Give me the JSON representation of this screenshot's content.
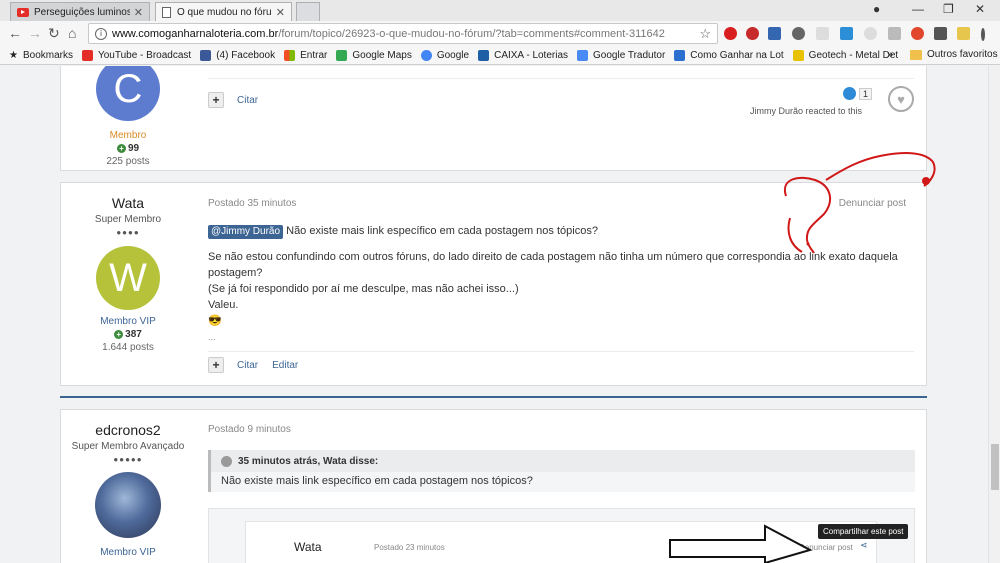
{
  "browser": {
    "tabs": [
      {
        "title": "Perseguições luminosas"
      },
      {
        "title": "O que mudou no fórum"
      }
    ],
    "url_host": "www.comoganharnaloteria.com.br",
    "url_path": "/forum/topico/26923-o-que-mudou-no-fórum/?tab=comments#comment-311642",
    "bookmarks": [
      {
        "label": "Bookmarks",
        "icon": "star-icon"
      },
      {
        "label": "YouTube - Broadcast",
        "icon": "youtube-icon"
      },
      {
        "label": "(4) Facebook",
        "icon": "facebook-icon"
      },
      {
        "label": "Entrar",
        "icon": "microsoft-icon"
      },
      {
        "label": "Google Maps",
        "icon": "maps-icon"
      },
      {
        "label": "Google",
        "icon": "google-icon"
      },
      {
        "label": "CAIXA - Loterias",
        "icon": "caixa-icon"
      },
      {
        "label": "Google Tradutor",
        "icon": "translate-icon"
      },
      {
        "label": "Como Ganhar na Lot",
        "icon": "site-icon"
      },
      {
        "label": "Geotech - Metal Det",
        "icon": "geotech-icon"
      }
    ],
    "bookmarks_overflow": "»",
    "other_bookmarks": "Outros favoritos"
  },
  "post1": {
    "avatar_letter": "C",
    "group": "Membro",
    "reputation": "99",
    "posts": "225 posts",
    "action_quote": "Citar",
    "reaction_count": "1",
    "reaction_text": "Jimmy Durão reacted to this"
  },
  "post2": {
    "author": "Wata",
    "title": "Super Membro",
    "pips": "●●●●",
    "avatar_letter": "W",
    "group": "Membro VIP",
    "reputation": "387",
    "posts": "1.644 posts",
    "posted": "Postado 35 minutos",
    "report": "Denunciar post",
    "mention": "@Jimmy Durão",
    "line1": "Não existe mais link específico em cada postagem nos tópicos?",
    "line2": "Se não estou confundindo com outros fóruns, do lado direito de cada postagem não tinha um número que correspondia ao link exato daquela postagem?",
    "line3": "(Se já foi respondido por aí me desculpe, mas não achei isso...)",
    "line4": "Valeu.",
    "emoji": "😎",
    "ellipsis": "...",
    "action_quote": "Citar",
    "action_edit": "Editar"
  },
  "post3": {
    "author": "edcronos2",
    "title": "Super Membro Avançado",
    "pips": "●●●●●",
    "group": "Membro VIP",
    "posted": "Postado 9 minutos",
    "quote_head": "35 minutos atrás, Wata disse:",
    "quote_body": "Não existe mais link específico em cada postagem nos tópicos?",
    "embed_author": "Wata",
    "embed_posted": "Postado 23 minutos",
    "embed_report": "Denunciar post",
    "tooltip": "Compartilhar este post"
  },
  "colors": {
    "accent": "#3d6594",
    "membro": "#d98b24",
    "vip": "#3d6594",
    "annotation": "#d01818"
  }
}
